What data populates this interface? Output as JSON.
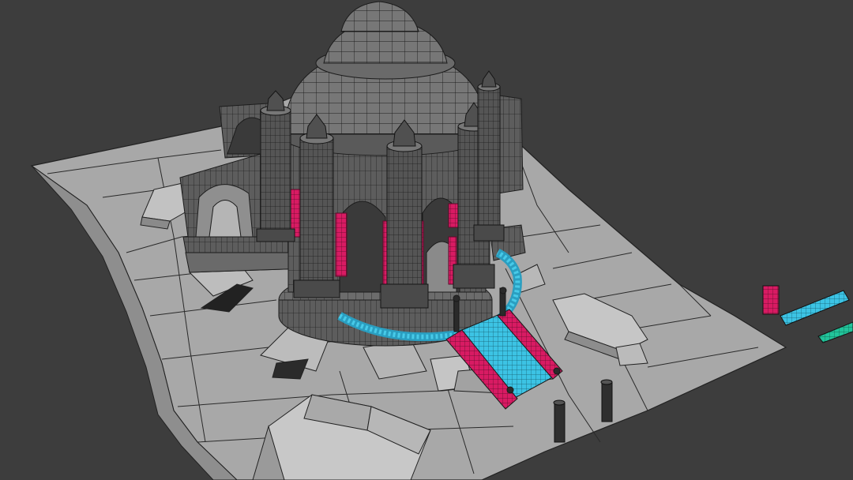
{
  "viewport": {
    "background": "#3d3d3d",
    "wire_color": "#1c1c1c",
    "mesh_color": "#6b6b6b",
    "ground_color": "#a7a7a7",
    "selection_colors": [
      "#d81b63",
      "#27b6d8",
      "#22c39a"
    ]
  },
  "scene": {
    "objects": [
      "ground-plane",
      "domed-rotunda",
      "columns",
      "side-arcade",
      "stair-ramp",
      "circular-platform",
      "bollard-posts",
      "rock-debris",
      "loose-parts"
    ]
  }
}
